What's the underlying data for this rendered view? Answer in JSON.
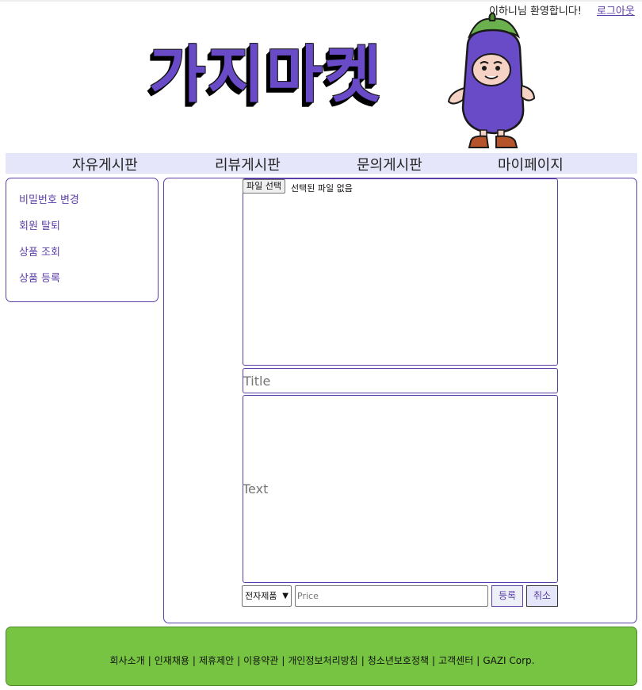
{
  "header": {
    "welcome": "이하니님 환영합니다!",
    "logout": "로그아웃",
    "logo_text": "가지마켓"
  },
  "nav": {
    "items": [
      "자유게시판",
      "리뷰게시판",
      "문의게시판",
      "마이페이지"
    ]
  },
  "sidebar": {
    "items": [
      "비밀번호 변경",
      "회원 탈퇴",
      "상품 조회",
      "상품 등록"
    ]
  },
  "form": {
    "file_button": "파일 선택",
    "file_status": "선택된 파일 없음",
    "title_placeholder": "Title",
    "text_placeholder": "Text",
    "category_selected": "전자제품",
    "price_placeholder": "Price",
    "register_label": "등록",
    "cancel_label": "취소"
  },
  "footer": {
    "links": [
      "회사소개",
      "인재채용",
      "제휴제안",
      "이용약관",
      "개인정보처리방침",
      "청소년보호정책",
      "고객센터",
      "GAZI Corp."
    ]
  },
  "colors": {
    "brand_purple": "#6a4bc7",
    "nav_bg": "#e6e6fa",
    "footer_green": "#76c442",
    "border_purple": "#5b3fa8"
  }
}
